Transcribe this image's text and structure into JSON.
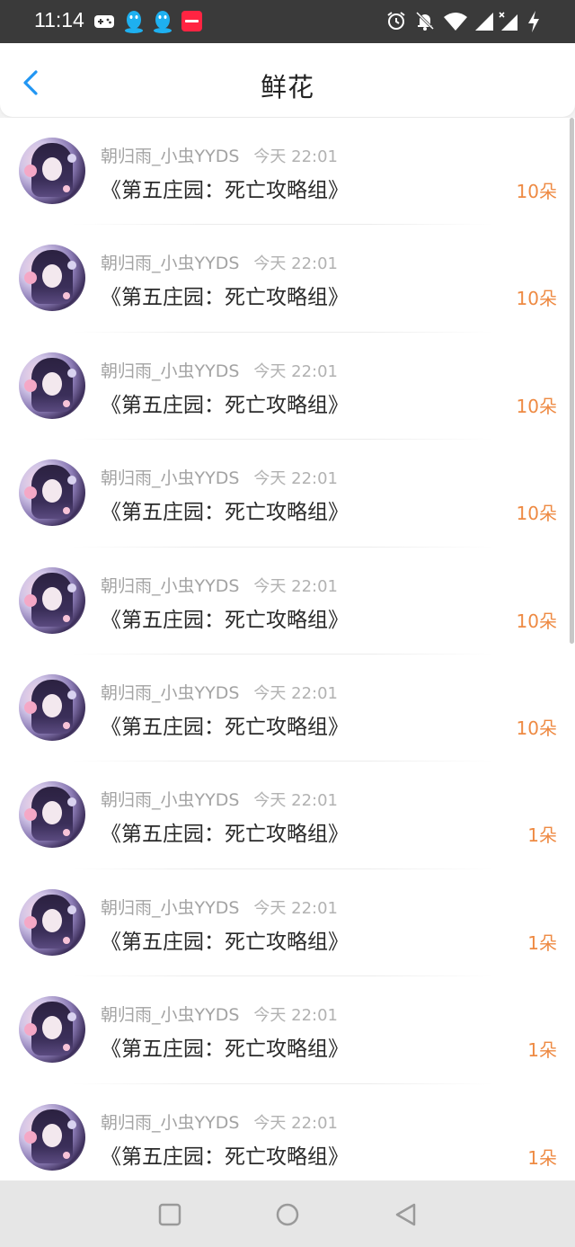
{
  "status_bar": {
    "time": "11:14",
    "icons": [
      "game-controller-icon",
      "qq-icon",
      "qq-icon",
      "xiaohongshu-icon",
      "alarm-icon",
      "bell-off-icon",
      "wifi-icon",
      "signal-icon",
      "signal-x-icon",
      "charging-icon"
    ],
    "background": "#3a3a3a"
  },
  "header": {
    "title": "鲜花",
    "back_icon": "chevron-left-icon",
    "accent": "#2196f3"
  },
  "list": {
    "amount_color": "#ee8a43",
    "items": [
      {
        "name": "朝归雨_小虫YYDS",
        "time": "今天 22:01",
        "title": "《第五庄园：死亡攻略组》",
        "amount": "10朵"
      },
      {
        "name": "朝归雨_小虫YYDS",
        "time": "今天 22:01",
        "title": "《第五庄园：死亡攻略组》",
        "amount": "10朵"
      },
      {
        "name": "朝归雨_小虫YYDS",
        "time": "今天 22:01",
        "title": "《第五庄园：死亡攻略组》",
        "amount": "10朵"
      },
      {
        "name": "朝归雨_小虫YYDS",
        "time": "今天 22:01",
        "title": "《第五庄园：死亡攻略组》",
        "amount": "10朵"
      },
      {
        "name": "朝归雨_小虫YYDS",
        "time": "今天 22:01",
        "title": "《第五庄园：死亡攻略组》",
        "amount": "10朵"
      },
      {
        "name": "朝归雨_小虫YYDS",
        "time": "今天 22:01",
        "title": "《第五庄园：死亡攻略组》",
        "amount": "10朵"
      },
      {
        "name": "朝归雨_小虫YYDS",
        "time": "今天 22:01",
        "title": "《第五庄园：死亡攻略组》",
        "amount": "1朵"
      },
      {
        "name": "朝归雨_小虫YYDS",
        "time": "今天 22:01",
        "title": "《第五庄园：死亡攻略组》",
        "amount": "1朵"
      },
      {
        "name": "朝归雨_小虫YYDS",
        "time": "今天 22:01",
        "title": "《第五庄园：死亡攻略组》",
        "amount": "1朵"
      },
      {
        "name": "朝归雨_小虫YYDS",
        "time": "今天 22:01",
        "title": "《第五庄园：死亡攻略组》",
        "amount": "1朵"
      }
    ]
  },
  "nav_bar": {
    "buttons": [
      "recents-square-icon",
      "home-circle-icon",
      "back-triangle-icon"
    ]
  }
}
